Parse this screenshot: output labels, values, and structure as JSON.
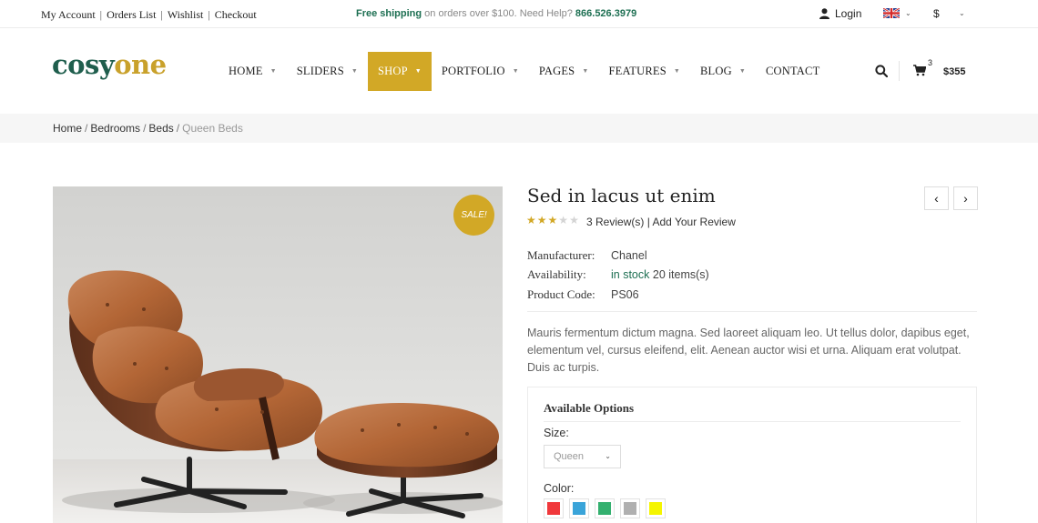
{
  "topbar": {
    "links": [
      "My Account",
      "Orders List",
      "Wishlist",
      "Checkout"
    ],
    "shipping_bold": "Free shipping",
    "shipping_text": " on orders over $100. Need Help? ",
    "phone": "866.526.3979",
    "login": "Login",
    "flag_icon": "uk-flag-icon",
    "currency": "$"
  },
  "header": {
    "logo_part1": "cosy",
    "logo_part2": "one",
    "nav": [
      {
        "label": "HOME",
        "caret": true
      },
      {
        "label": "SLIDERS",
        "caret": true
      },
      {
        "label": "SHOP",
        "caret": true,
        "active": true
      },
      {
        "label": "PORTFOLIO",
        "caret": true
      },
      {
        "label": "PAGES",
        "caret": true
      },
      {
        "label": "FEATURES",
        "caret": true
      },
      {
        "label": "BLOG",
        "caret": true
      },
      {
        "label": "CONTACT",
        "caret": false
      }
    ],
    "cart_count": "3",
    "cart_total": "$355"
  },
  "breadcrumb": [
    "Home",
    "Bedrooms",
    "Beds",
    "Queen Beds"
  ],
  "product": {
    "sale_badge": "SALE!",
    "title": "Sed in lacus ut enim",
    "rating": 3,
    "rating_max": 5,
    "reviews_text": "3 Review(s)",
    "add_review": "Add Your Review",
    "attributes": [
      {
        "key": "Manufacturer:",
        "value": "Chanel"
      },
      {
        "key": "Availability:",
        "value_stock": "in stock",
        "value": " 20 items(s)"
      },
      {
        "key": "Product Code:",
        "value": "PS06"
      }
    ],
    "description": "Mauris fermentum dictum magna. Sed laoreet aliquam leo. Ut tellus dolor, dapibus eget, elementum vel, cursus eleifend, elit. Aenean auctor wisi et urna. Aliquam erat volutpat. Duis ac turpis.",
    "options_title": "Available Options",
    "size_label": "Size:",
    "size_value": "Queen",
    "color_label": "Color:",
    "colors": [
      "#f0383b",
      "#3aa4d9",
      "#34b06f",
      "#b0b0b0",
      "#f5f500"
    ]
  },
  "colors": {
    "accent": "#d2a826",
    "brand_green": "#1f5e4d"
  }
}
